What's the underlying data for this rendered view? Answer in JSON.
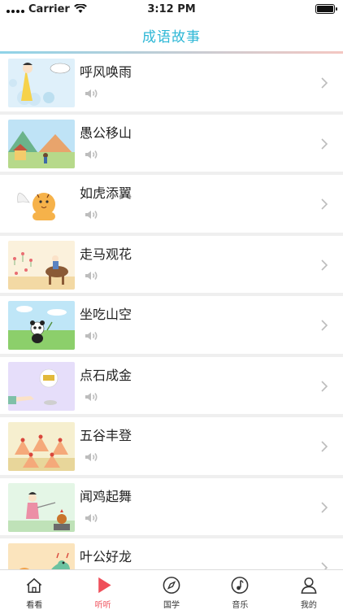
{
  "status_bar": {
    "carrier": "Carrier",
    "time": "3:12 PM"
  },
  "header": {
    "title": "成语故事"
  },
  "stories": [
    {
      "title": "呼风唤雨",
      "thumb_icon": "fairy-clouds-illustration"
    },
    {
      "title": "愚公移山",
      "thumb_icon": "mountain-landscape-illustration"
    },
    {
      "title": "如虎添翼",
      "thumb_icon": "winged-tiger-illustration"
    },
    {
      "title": "走马观花",
      "thumb_icon": "horse-rider-flowers-illustration"
    },
    {
      "title": "坐吃山空",
      "thumb_icon": "panda-meadow-illustration"
    },
    {
      "title": "点石成金",
      "thumb_icon": "finger-gold-illustration"
    },
    {
      "title": "五谷丰登",
      "thumb_icon": "grain-stacks-illustration"
    },
    {
      "title": "闻鸡起舞",
      "thumb_icon": "sword-dancer-rooster-illustration"
    },
    {
      "title": "叶公好龙",
      "thumb_icon": "dragon-illustration"
    }
  ],
  "tabs": [
    {
      "label": "看看",
      "icon": "house-icon",
      "active": false
    },
    {
      "label": "听听",
      "icon": "play-icon",
      "active": true
    },
    {
      "label": "国学",
      "icon": "compass-icon",
      "active": false
    },
    {
      "label": "音乐",
      "icon": "music-note-icon",
      "active": false
    },
    {
      "label": "我的",
      "icon": "person-icon",
      "active": false
    }
  ],
  "colors": {
    "accent": "#2db7d6",
    "active_tab": "#ef4f5a"
  }
}
